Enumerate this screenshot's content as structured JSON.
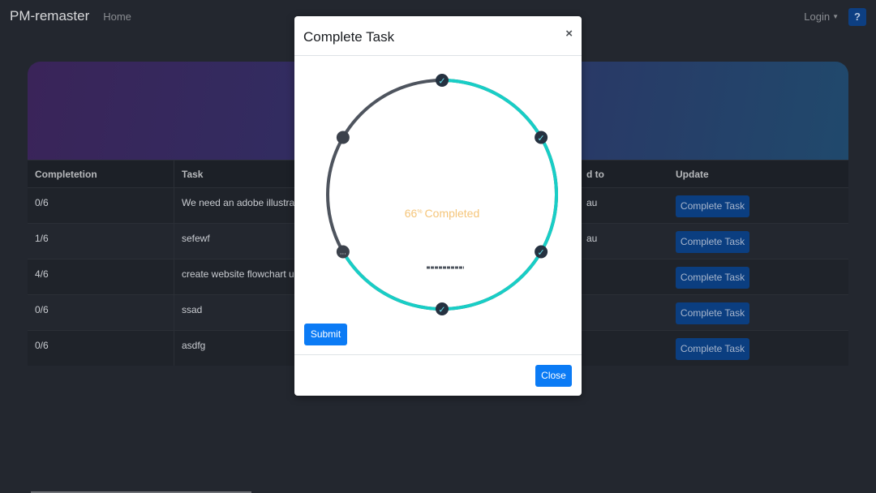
{
  "navbar": {
    "brand": "PM-remaster",
    "home": "Home",
    "login": "Login",
    "help": "?"
  },
  "table": {
    "headers": [
      "Completetion",
      "Task",
      "d to",
      "Update"
    ],
    "rows": [
      {
        "completion": "0/6",
        "task": "We need an adobe illustrati",
        "assigned": "au",
        "button": "Complete Task"
      },
      {
        "completion": "1/6",
        "task": "sefewf",
        "assigned": "au",
        "button": "Complete Task"
      },
      {
        "completion": "4/6",
        "task": "create website flowchart us",
        "assigned": "",
        "button": "Complete Task"
      },
      {
        "completion": "0/6",
        "task": "ssad",
        "assigned": "",
        "button": "Complete Task"
      },
      {
        "completion": "0/6",
        "task": "asdfg",
        "assigned": "",
        "button": "Complete Task"
      }
    ]
  },
  "modal": {
    "title": "Complete Task",
    "close_icon": "×",
    "progress_value": "66",
    "progress_unit": "%",
    "progress_label": "Completed",
    "progress_fraction": 0.6667,
    "checkpoints": [
      "done",
      "done",
      "done",
      "done",
      "pending",
      "current"
    ],
    "submit": "Submit",
    "close": "Close"
  },
  "colors": {
    "ring_done": "#18cec6",
    "ring_pending": "#4e545e",
    "node": "#253140",
    "check": "#6fe3ee",
    "progress_text": "#f5c57a",
    "primary": "#0b7bf5"
  }
}
